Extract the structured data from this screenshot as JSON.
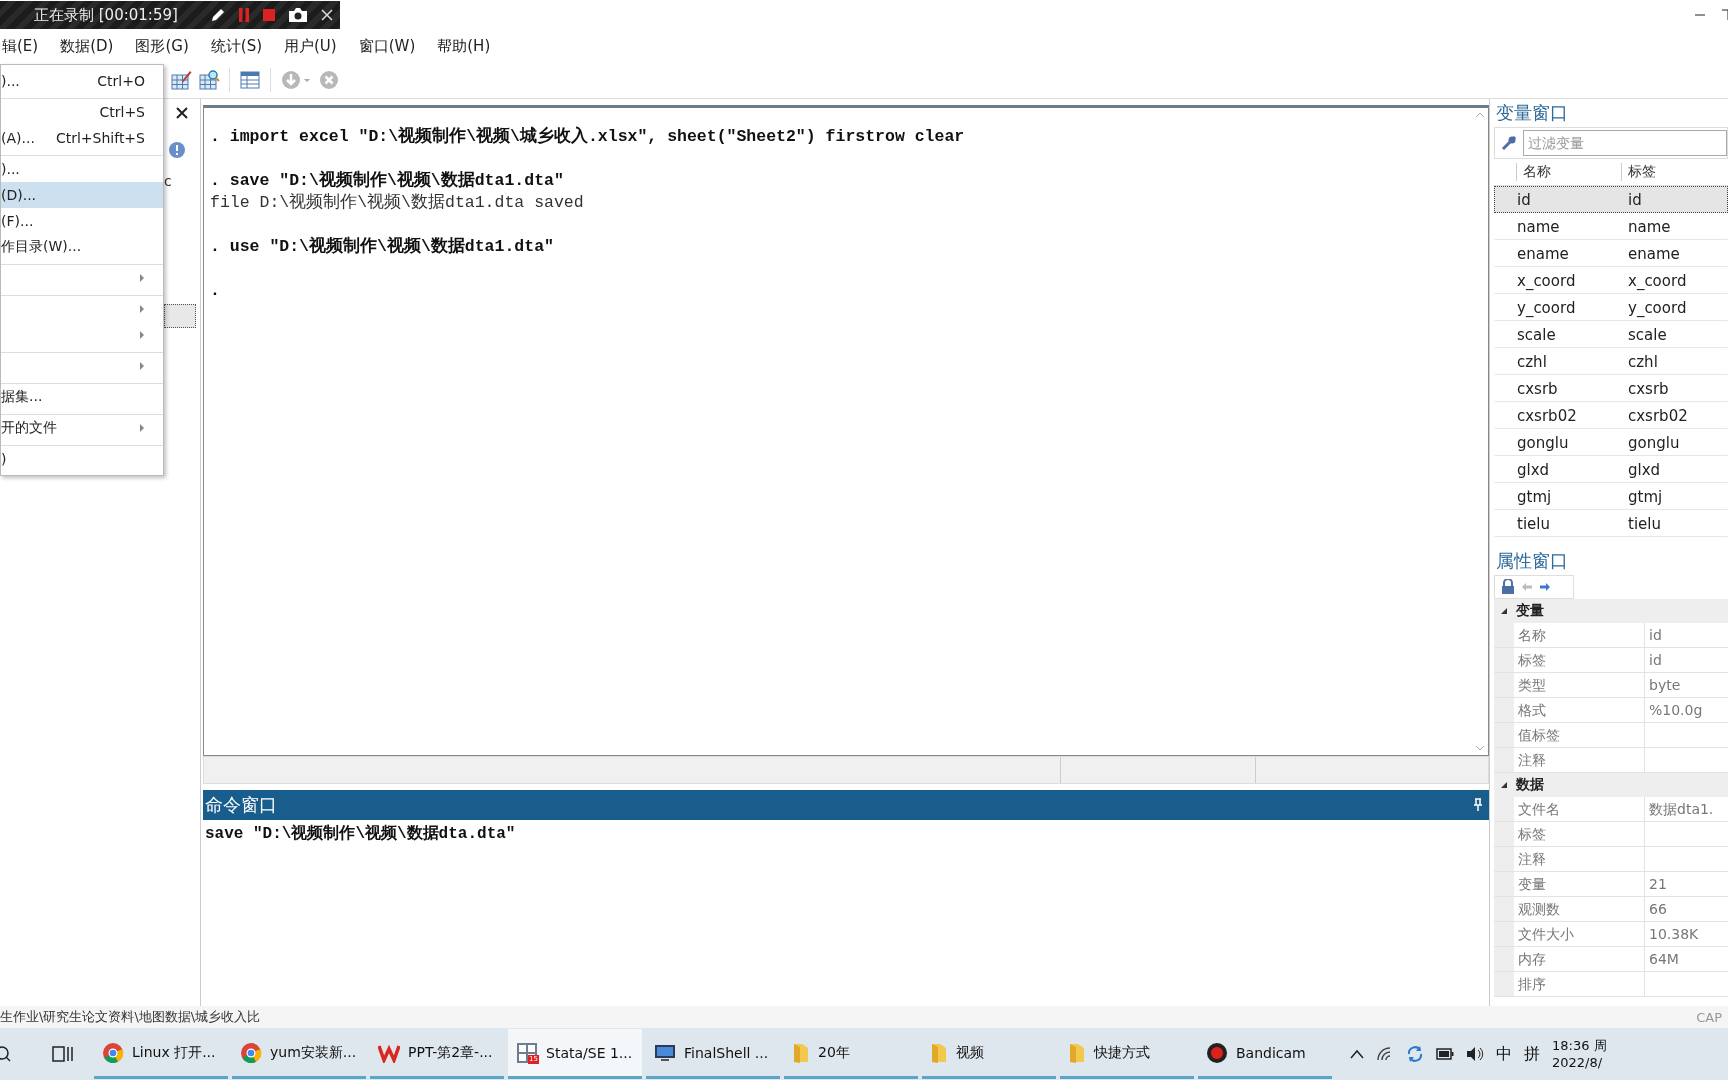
{
  "recorder": {
    "status": "正在录制 [00:01:59]",
    "recording": true
  },
  "menu_bar": [
    "辑(E)",
    "数据(D)",
    "图形(G)",
    "统计(S)",
    "用户(U)",
    "窗口(W)",
    "帮助(H)"
  ],
  "file_menu": [
    {
      "label": ")...",
      "shortcut": "Ctrl+O",
      "submenu": false,
      "selected": false,
      "separator_before": false
    },
    {
      "shortcut": "Ctrl+S",
      "submenu": false,
      "selected": false,
      "separator_before": true
    },
    {
      "label": "(A)...",
      "shortcut": "Ctrl+Shift+S",
      "submenu": false,
      "selected": false,
      "separator_before": false
    },
    {
      "label": ")...",
      "submenu": false,
      "selected": false,
      "separator_before": true
    },
    {
      "label": "(D)...",
      "submenu": false,
      "selected": true,
      "separator_before": false
    },
    {
      "label": "(F)...",
      "submenu": false,
      "selected": false,
      "separator_before": false
    },
    {
      "label": "作目录(W)...",
      "submenu": false,
      "selected": false,
      "separator_before": false
    },
    {
      "submenu": true,
      "selected": false,
      "separator_before": true
    },
    {
      "submenu": true,
      "selected": false,
      "separator_before": true
    },
    {
      "submenu": true,
      "selected": false,
      "separator_before": false
    },
    {
      "submenu": true,
      "selected": false,
      "separator_before": true
    },
    {
      "label": "据集...",
      "submenu": false,
      "selected": false,
      "separator_before": true
    },
    {
      "label": "开的文件",
      "submenu": true,
      "selected": false,
      "separator_before": true
    },
    {
      "label": ")",
      "submenu": false,
      "selected": false,
      "separator_before": true
    }
  ],
  "side_panel": {
    "column_label": "c"
  },
  "results": [
    {
      "kind": "command",
      "text": ". import excel \"D:\\视频制作\\视频\\城乡收入.xlsx\", sheet(\"Sheet2\") firstrow clear"
    },
    {
      "kind": "command",
      "text": ". save \"D:\\视频制作\\视频\\数据dta1.dta\""
    },
    {
      "kind": "output",
      "text": "file D:\\视频制作\\视频\\数据dta1.dta saved"
    },
    {
      "kind": "command",
      "text": ". use \"D:\\视频制作\\视频\\数据dta1.dta\""
    },
    {
      "kind": "prompt",
      "text": "."
    }
  ],
  "command_window": {
    "title": "命令窗口",
    "value": "save \"D:\\视频制作\\视频\\数据dta.dta\""
  },
  "variables_window": {
    "title": "变量窗口",
    "filter": {
      "placeholder": "过滤变量"
    },
    "columns": [
      "名称",
      "标签"
    ],
    "rows": [
      {
        "name": "id",
        "label": "id",
        "selected": true
      },
      {
        "name": "name",
        "label": "name",
        "selected": false
      },
      {
        "name": "ename",
        "label": "ename",
        "selected": false
      },
      {
        "name": "x_coord",
        "label": "x_coord",
        "selected": false
      },
      {
        "name": "y_coord",
        "label": "y_coord",
        "selected": false
      },
      {
        "name": "scale",
        "label": "scale",
        "selected": false
      },
      {
        "name": "czhl",
        "label": "czhl",
        "selected": false
      },
      {
        "name": "cxsrb",
        "label": "cxsrb",
        "selected": false
      },
      {
        "name": "cxsrb02",
        "label": "cxsrb02",
        "selected": false
      },
      {
        "name": "gonglu",
        "label": "gonglu",
        "selected": false
      },
      {
        "name": "glxd",
        "label": "glxd",
        "selected": false
      },
      {
        "name": "gtmj",
        "label": "gtmj",
        "selected": false
      },
      {
        "name": "tielu",
        "label": "tielu",
        "selected": false
      }
    ]
  },
  "properties_window": {
    "title": "属性窗口",
    "groups": [
      {
        "title": "变量",
        "expanded": true,
        "rows": [
          {
            "name": "名称",
            "value": "id"
          },
          {
            "name": "标签",
            "value": "id"
          },
          {
            "name": "类型",
            "value": "byte"
          },
          {
            "name": "格式",
            "value": "%10.0g"
          },
          {
            "name": "值标签"
          },
          {
            "name": "注释"
          }
        ]
      },
      {
        "title": "数据",
        "expanded": true,
        "rows": [
          {
            "name": "文件名",
            "value": "数据dta1."
          },
          {
            "name": "标签"
          },
          {
            "name": "注释"
          },
          {
            "name": "变量",
            "value": "21"
          },
          {
            "name": "观测数",
            "value": "66"
          },
          {
            "name": "文件大小",
            "value": "10.38K"
          },
          {
            "name": "内存",
            "value": "64M"
          },
          {
            "name": "排序"
          }
        ]
      }
    ]
  },
  "status_bar": {
    "path": "生作业\\研究生论文资料\\地图数据\\城乡收入比",
    "indicator": "CAP"
  },
  "taskbar": {
    "apps": [
      {
        "kind": "chrome",
        "label": "Linux 打开...",
        "active": false
      },
      {
        "kind": "chrome",
        "label": "yum安装新...",
        "active": false
      },
      {
        "kind": "wps",
        "label": "PPT-第2章-...",
        "active": false
      },
      {
        "kind": "stata",
        "label": "Stata/SE 1...",
        "badge": "15",
        "active": true
      },
      {
        "kind": "terminal",
        "label": "FinalShell ...",
        "active": false
      },
      {
        "kind": "folder",
        "label": "20年",
        "active": false
      },
      {
        "kind": "folder",
        "label": "视频",
        "active": false
      },
      {
        "kind": "folder",
        "label": "快捷方式",
        "active": false
      },
      {
        "kind": "record",
        "label": "Bandicam",
        "active": false
      }
    ],
    "tray": {
      "ime_mode": "中",
      "ime": "拼",
      "time": "18:36 周",
      "date": "2022/8/"
    }
  }
}
